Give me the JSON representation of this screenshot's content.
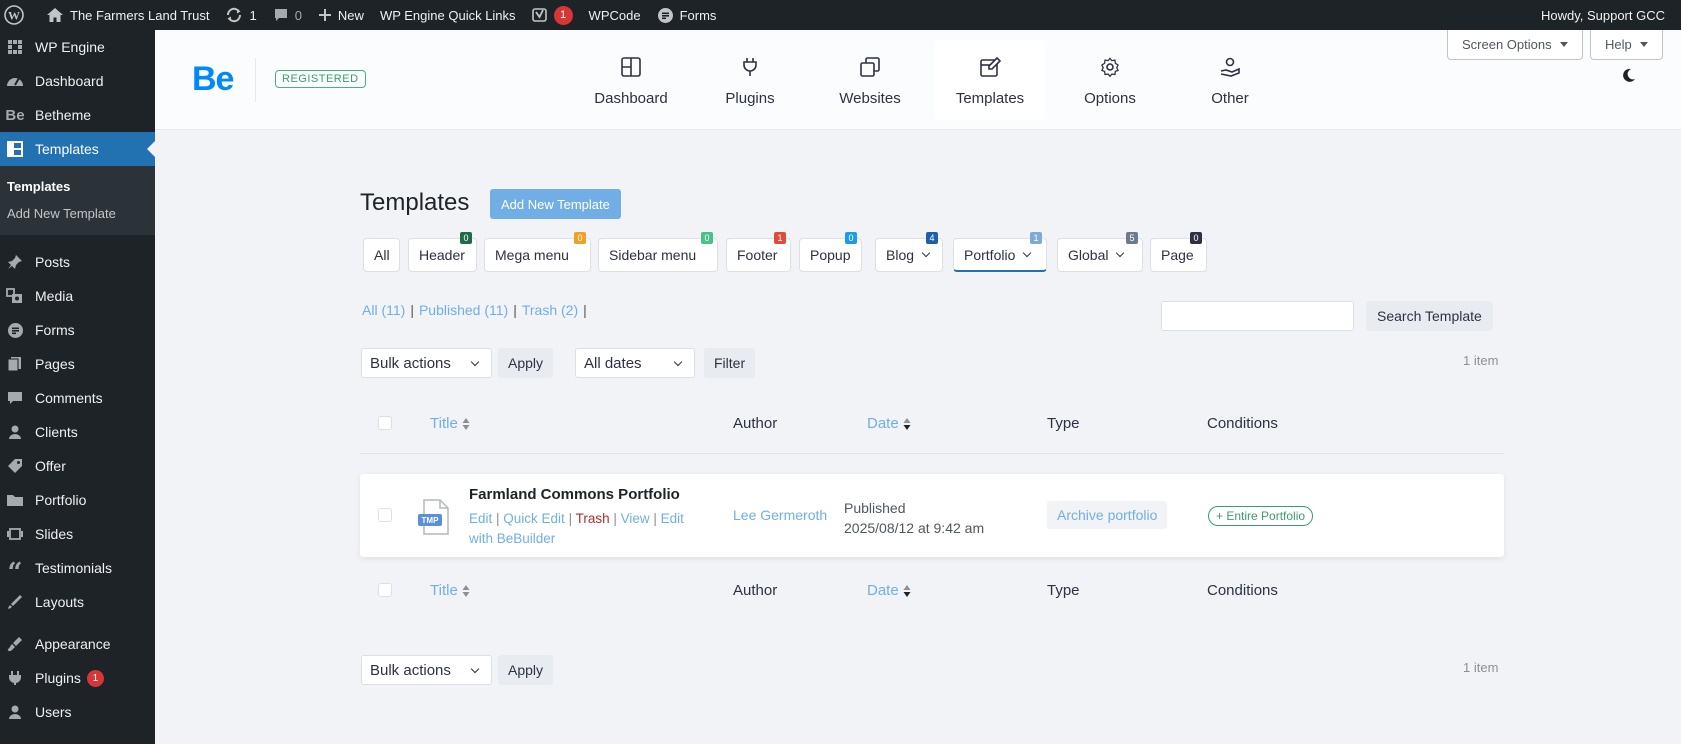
{
  "adminbar": {
    "site_name": "The Farmers Land Trust",
    "updates_count": "1",
    "comments_count": "0",
    "new_label": "New",
    "quick_links": "WP Engine Quick Links",
    "yoast_badge": "1",
    "wpcode": "WPCode",
    "forms": "Forms",
    "howdy": "Howdy, Support GCC"
  },
  "sidebar": {
    "items": [
      {
        "label": "WP Engine",
        "icon": "wp-engine-icon"
      },
      {
        "label": "Dashboard",
        "icon": "dashboard-icon"
      },
      {
        "label": "Betheme",
        "icon": "betheme-icon"
      },
      {
        "label": "Templates",
        "icon": "templates-icon"
      },
      {
        "label": "Posts",
        "icon": "pin-icon"
      },
      {
        "label": "Media",
        "icon": "media-icon"
      },
      {
        "label": "Forms",
        "icon": "forms-icon"
      },
      {
        "label": "Pages",
        "icon": "pages-icon"
      },
      {
        "label": "Comments",
        "icon": "comments-icon"
      },
      {
        "label": "Clients",
        "icon": "clients-icon"
      },
      {
        "label": "Offer",
        "icon": "tag-icon"
      },
      {
        "label": "Portfolio",
        "icon": "folder-icon"
      },
      {
        "label": "Slides",
        "icon": "slides-icon"
      },
      {
        "label": "Testimonials",
        "icon": "quote-icon"
      },
      {
        "label": "Layouts",
        "icon": "brush-icon"
      },
      {
        "label": "Appearance",
        "icon": "appearance-icon"
      },
      {
        "label": "Plugins",
        "icon": "plugins-icon",
        "badge": "1"
      },
      {
        "label": "Users",
        "icon": "users-icon"
      }
    ],
    "submenu": [
      "Templates",
      "Add New Template"
    ]
  },
  "beheader": {
    "logo": "Be",
    "registered": "REGISTERED",
    "tabs": [
      "Dashboard",
      "Plugins",
      "Websites",
      "Templates",
      "Options",
      "Other"
    ],
    "active_tab": "Templates",
    "screen_options": "Screen Options",
    "help": "Help"
  },
  "page": {
    "title": "Templates",
    "add_new": "Add New Template",
    "type_filters": [
      {
        "label": "All"
      },
      {
        "label": "Header",
        "count": "0",
        "color": "#1e6b4a"
      },
      {
        "label": "Mega menu",
        "count": "0",
        "color": "#f0a024"
      },
      {
        "label": "Sidebar menu",
        "count": "0",
        "color": "#4cc08a"
      },
      {
        "label": "Footer",
        "count": "1",
        "color": "#e24b3b"
      },
      {
        "label": "Popup",
        "count": "0",
        "color": "#1e9be8"
      },
      {
        "label": "Blog",
        "count": "4",
        "color": "#1f5fa8"
      },
      {
        "label": "Portfolio",
        "count": "1",
        "color": "#7fa9d6"
      },
      {
        "label": "Global",
        "count": "5",
        "color": "#6d7a8c"
      },
      {
        "label": "Page",
        "count": "0",
        "color": "#2d3142"
      }
    ],
    "status_links": {
      "all": "All",
      "all_count": "(11)",
      "published": "Published",
      "published_count": "(11)",
      "trash": "Trash",
      "trash_count": "(2)"
    },
    "search_button": "Search Template",
    "bulk_actions": "Bulk actions",
    "apply": "Apply",
    "all_dates": "All dates",
    "filter": "Filter",
    "item_count": "1 item",
    "columns": [
      "Title",
      "Author",
      "Date",
      "Type",
      "Conditions"
    ]
  },
  "row": {
    "title": "Farmland Commons Portfolio",
    "actions": {
      "edit": "Edit",
      "quick_edit": "Quick Edit",
      "trash": "Trash",
      "view": "View",
      "edit_with": "Edit with BeBuilder"
    },
    "icon_label": "TMP",
    "author": "Lee Germeroth",
    "date_status": "Published",
    "date_value": "2025/08/12 at 9:42 am",
    "type": "Archive portfolio",
    "conditions": "+ Entire Portfolio"
  },
  "colors": {
    "admin_bg": "#1d2327",
    "accent": "#2271b1",
    "link": "#72aee6",
    "be_blue": "#0089f7",
    "success": "#3d9c6d",
    "trash": "#b32d2e"
  }
}
